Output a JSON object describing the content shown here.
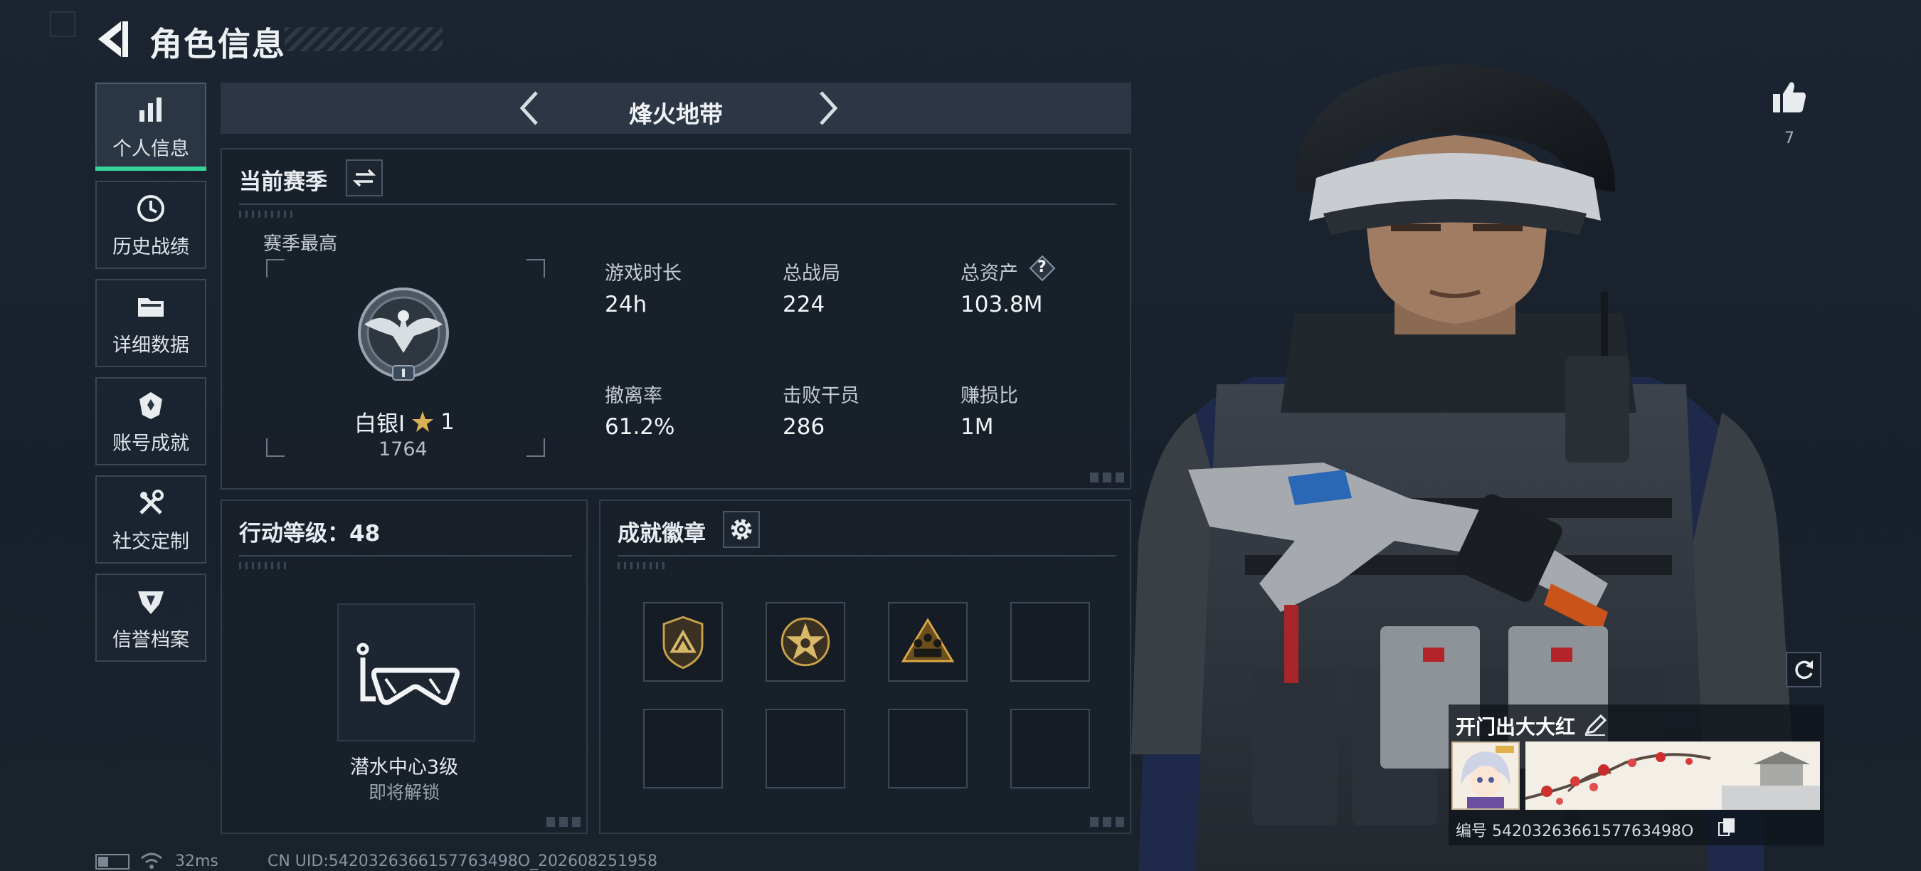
{
  "header": {
    "title": "角色信息"
  },
  "sidebar": {
    "items": [
      {
        "label": "个人信息",
        "icon": "bar-chart-icon",
        "active": true
      },
      {
        "label": "历史战绩",
        "icon": "clock-icon"
      },
      {
        "label": "详细数据",
        "icon": "folder-icon"
      },
      {
        "label": "账号成就",
        "icon": "achievement-icon"
      },
      {
        "label": "社交定制",
        "icon": "tools-icon"
      },
      {
        "label": "信誉档案",
        "icon": "credit-icon"
      }
    ]
  },
  "mode": {
    "title": "烽火地带"
  },
  "season": {
    "title": "当前赛季",
    "best_label": "赛季最高",
    "rank_name": "白银I",
    "rank_star_level": "1",
    "rank_score": "1764",
    "stats": [
      {
        "label": "游戏时长",
        "value": "24h"
      },
      {
        "label": "总战局",
        "value": "224"
      },
      {
        "label": "总资产",
        "value": "103.8M"
      },
      {
        "label": "撤离率",
        "value": "61.2%"
      },
      {
        "label": "击败干员",
        "value": "286"
      },
      {
        "label": "赚损比",
        "value": "1M"
      }
    ],
    "help_glyph": "?"
  },
  "action_level": {
    "title": "行动等级：48",
    "facility_name": "潜水中心3级",
    "facility_status": "即将解锁"
  },
  "badges": {
    "title": "成就徽章"
  },
  "likes": {
    "count": "7"
  },
  "nameplate": {
    "name": "开门出大大红",
    "id_text": "编号 5420326366157763498O"
  },
  "status_bar": {
    "ping": "32ms",
    "uid_text": "CN UID:5420326366157763498O_202608251958"
  },
  "colors": {
    "accent_green": "#35d39a",
    "panel_bg": "#18202a",
    "gold": "#c9a14a"
  }
}
